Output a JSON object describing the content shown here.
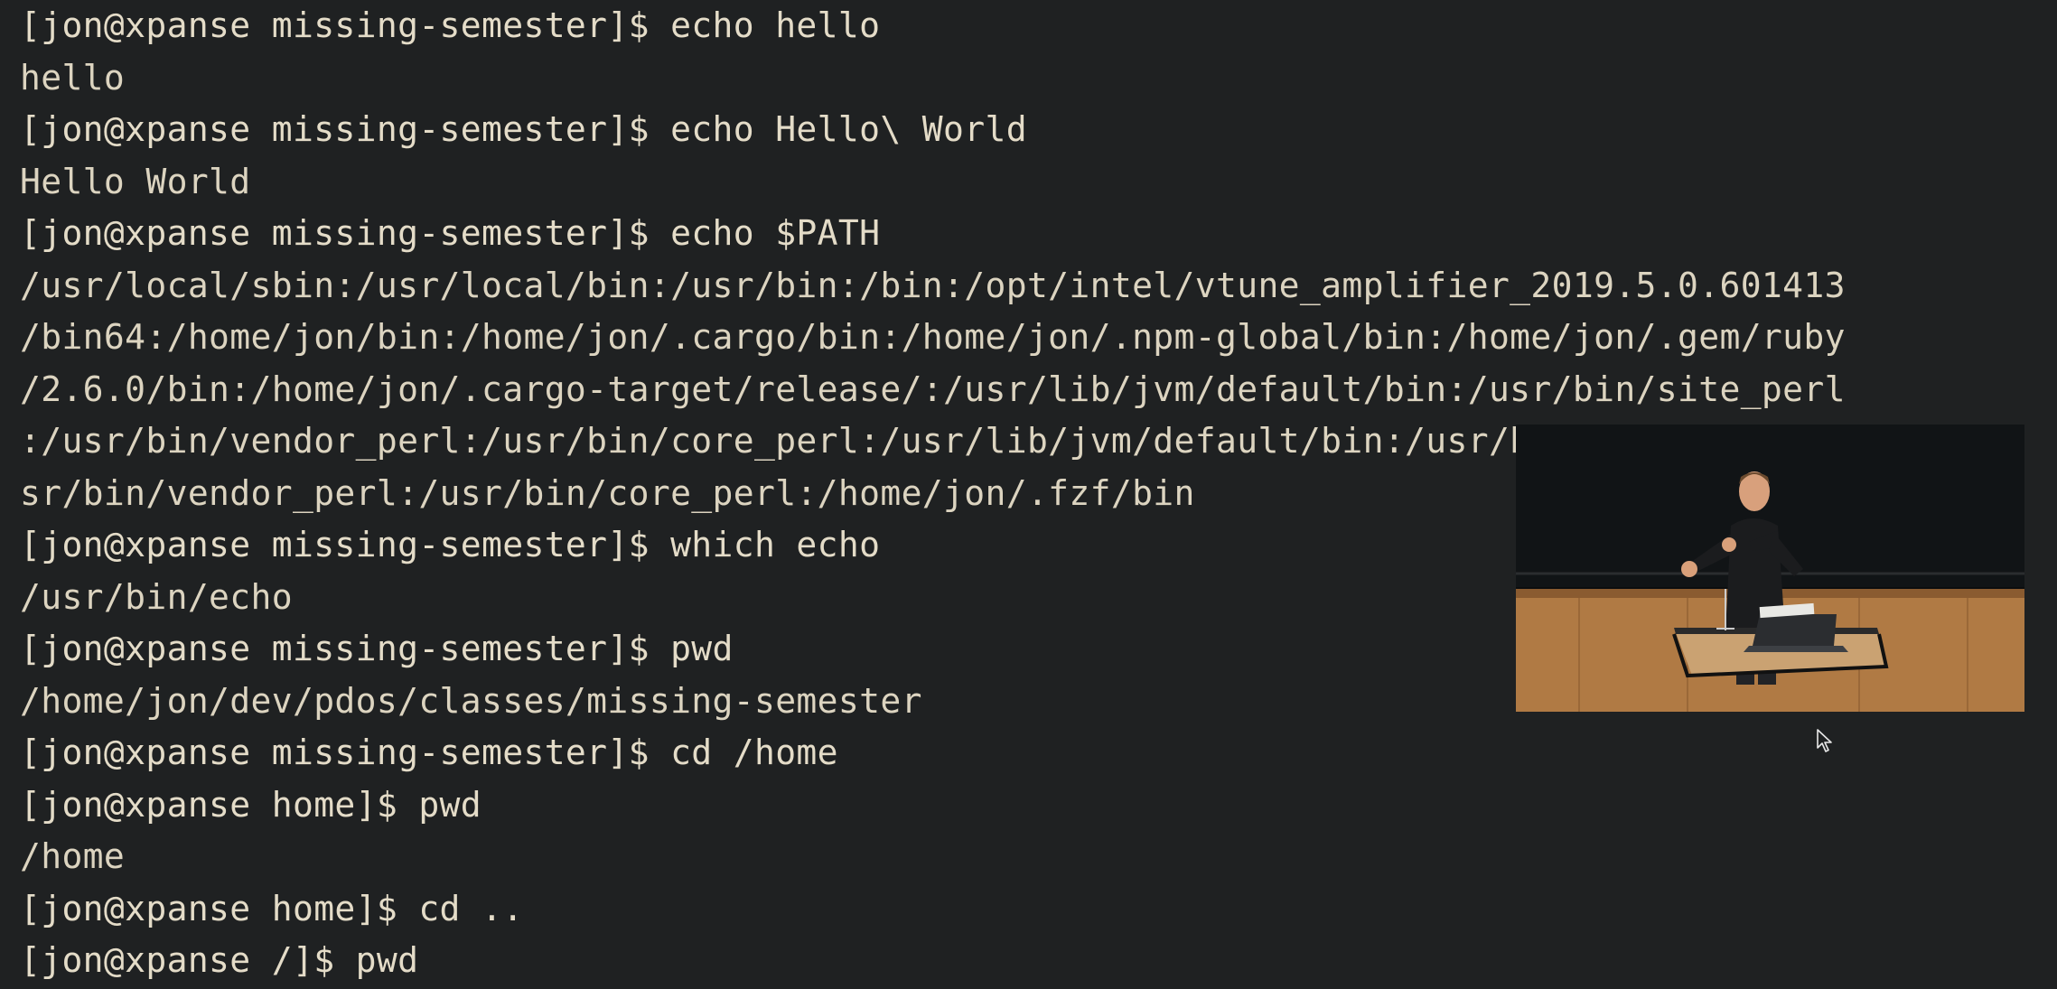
{
  "terminal": {
    "lines": [
      {
        "type": "prompt",
        "text": "[jon@xpanse missing-semester]$ echo hello"
      },
      {
        "type": "output",
        "text": "hello"
      },
      {
        "type": "prompt",
        "text": "[jon@xpanse missing-semester]$ echo Hello\\ World"
      },
      {
        "type": "output",
        "text": "Hello World"
      },
      {
        "type": "prompt",
        "text": "[jon@xpanse missing-semester]$ echo $PATH"
      },
      {
        "type": "output",
        "text": "/usr/local/sbin:/usr/local/bin:/usr/bin:/bin:/opt/intel/vtune_amplifier_2019.5.0.601413"
      },
      {
        "type": "output",
        "text": "/bin64:/home/jon/bin:/home/jon/.cargo/bin:/home/jon/.npm-global/bin:/home/jon/.gem/ruby"
      },
      {
        "type": "output",
        "text": "/2.6.0/bin:/home/jon/.cargo-target/release/:/usr/lib/jvm/default/bin:/usr/bin/site_perl"
      },
      {
        "type": "output",
        "text": ":/usr/bin/vendor_perl:/usr/bin/core_perl:/usr/lib/jvm/default/bin:/usr/bin/site_perl:/u"
      },
      {
        "type": "output",
        "text": "sr/bin/vendor_perl:/usr/bin/core_perl:/home/jon/.fzf/bin"
      },
      {
        "type": "prompt",
        "text": "[jon@xpanse missing-semester]$ which echo"
      },
      {
        "type": "output",
        "text": "/usr/bin/echo"
      },
      {
        "type": "prompt",
        "text": "[jon@xpanse missing-semester]$ pwd"
      },
      {
        "type": "output",
        "text": "/home/jon/dev/pdos/classes/missing-semester"
      },
      {
        "type": "prompt",
        "text": "[jon@xpanse missing-semester]$ cd /home"
      },
      {
        "type": "prompt",
        "text": "[jon@xpanse home]$ pwd"
      },
      {
        "type": "output",
        "text": "/home"
      },
      {
        "type": "prompt",
        "text": "[jon@xpanse home]$ cd .."
      },
      {
        "type": "prompt",
        "text": "[jon@xpanse /]$ pwd"
      }
    ]
  },
  "video_overlay": {
    "icon": "lecturer-video"
  },
  "cursor": {
    "icon": "mouse-pointer-icon"
  }
}
